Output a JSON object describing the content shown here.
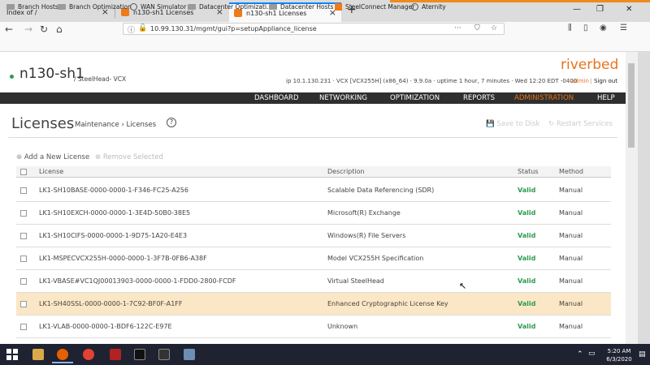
{
  "tabs": [
    {
      "label": "Index of /"
    },
    {
      "label": "n130-sh1 Licenses"
    },
    {
      "label": "n130-sh1 Licenses",
      "active": true
    }
  ],
  "url": "10.99.130.31/mgmt/gui?p=setupAppliance_license",
  "bookmarks": [
    "Branch Hosts",
    "Branch Optimization",
    "WAN Simulator",
    "Datacenter Optimizati...",
    "Datacenter Hosts",
    "SteelConnect Manager",
    "Aternity"
  ],
  "header": {
    "hostname": "n130-sh1",
    "subtitle": "/ SteelHead- VCX",
    "logo": "riverbed",
    "sysinfo": "ip 10.1.130.231  ·  VCX [VCX255H] (x86_64)  ·  9.9.0a  ·  uptime 1 hour, 7 minutes  ·  Wed 12:20 EDT -0400",
    "user": "admin",
    "signout": "Sign out"
  },
  "menu": [
    "DASHBOARD",
    "NETWORKING",
    "OPTIMIZATION",
    "REPORTS",
    "ADMINISTRATION",
    "HELP"
  ],
  "page": {
    "title": "Licenses",
    "breadcrumb": "Maintenance › Licenses",
    "help": "?",
    "save": "Save to Disk",
    "restart": "Restart Services",
    "add": "Add a New License",
    "remove": "Remove Selected"
  },
  "table": {
    "headers": [
      "License",
      "Description",
      "Status",
      "Method"
    ],
    "rows": [
      {
        "license": "LK1-SH10BASE-0000-0000-1-F346-FC25-A256",
        "description": "Scalable Data Referencing (SDR)",
        "status": "Valid",
        "method": "Manual"
      },
      {
        "license": "LK1-SH10EXCH-0000-0000-1-3E4D-50B0-38E5",
        "description": "Microsoft(R) Exchange",
        "status": "Valid",
        "method": "Manual"
      },
      {
        "license": "LK1-SH10CIFS-0000-0000-1-9D75-1A20-E4E3",
        "description": "Windows(R) File Servers",
        "status": "Valid",
        "method": "Manual"
      },
      {
        "license": "LK1-MSPECVCX255H-0000-0000-1-3F7B-0FB6-A38F",
        "description": "Model VCX255H Specification",
        "status": "Valid",
        "method": "Manual"
      },
      {
        "license": "LK1-VBASE#VC1QJ00013903-0000-0000-1-FDD0-2800-FCDF",
        "description": "Virtual SteelHead",
        "status": "Valid",
        "method": "Manual"
      },
      {
        "license": "LK1-SH40SSL-0000-0000-1-7C92-BF0F-A1FF",
        "description": "Enhanced Cryptographic License Key",
        "status": "Valid",
        "method": "Manual"
      },
      {
        "license": "LK1-VLAB-0000-0000-1-BDF6-122C-E97E",
        "description": "Unknown",
        "status": "Valid",
        "method": "Manual"
      }
    ]
  },
  "taskbar": {
    "time": "5:20 AM",
    "date": "6/3/2020"
  },
  "colors": {
    "accent": "#e8731a",
    "valid": "#2b9b4b",
    "menubar": "#2f2f2f",
    "highlight": "#fbe7c5"
  }
}
